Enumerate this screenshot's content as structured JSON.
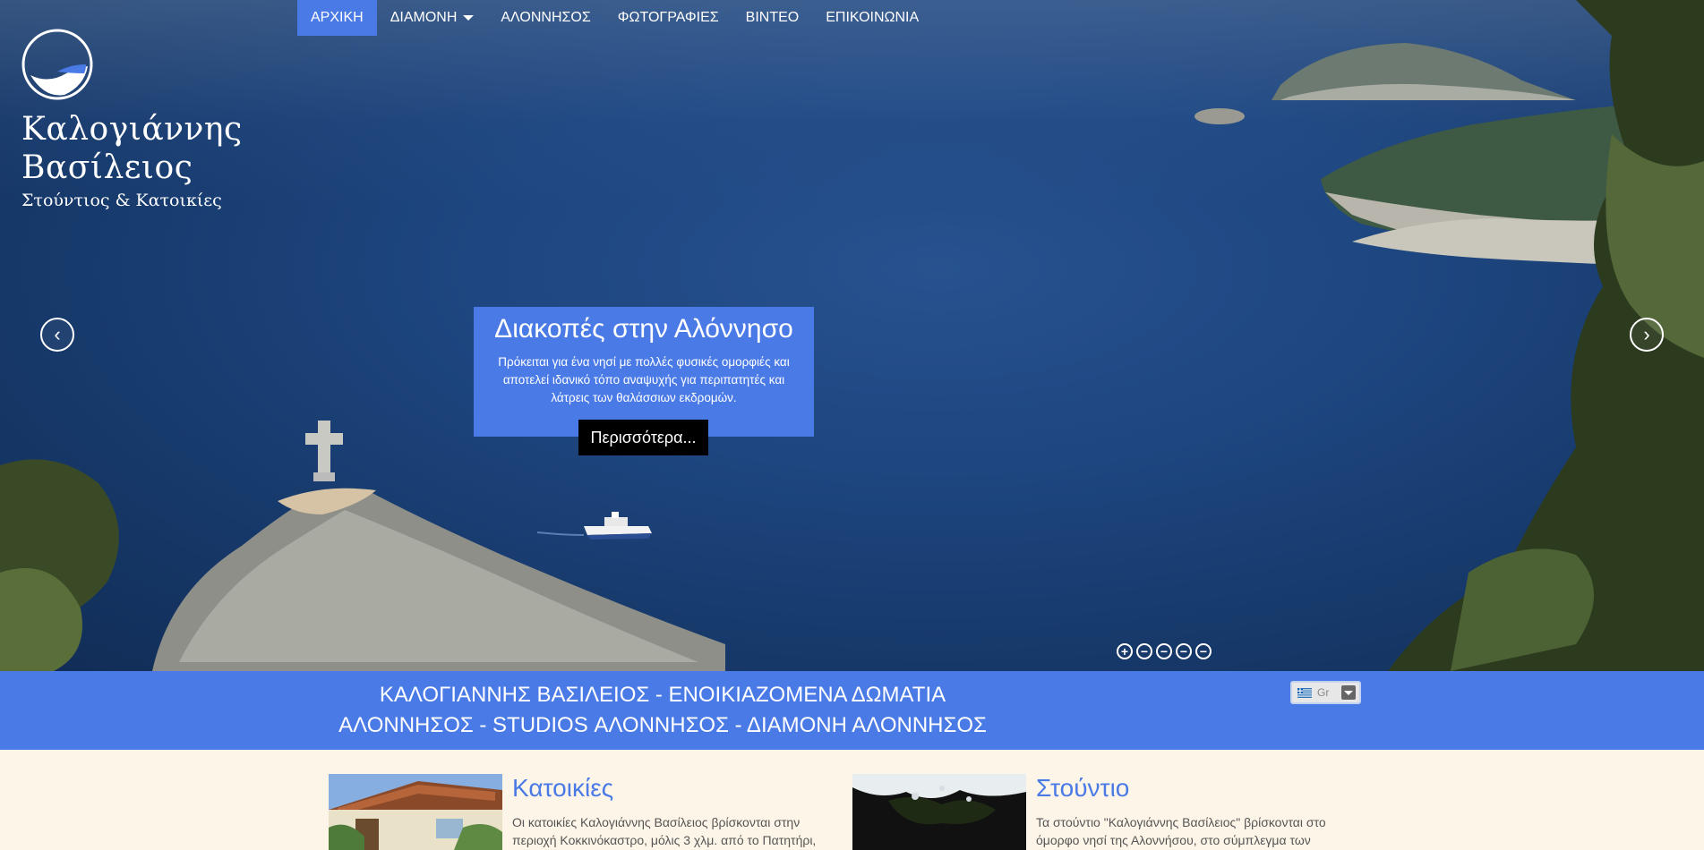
{
  "nav": {
    "items": [
      {
        "label": "ΑΡΧΙΚΗ",
        "active": true
      },
      {
        "label": "ΔΙΑΜΟΝΗ",
        "dropdown": true
      },
      {
        "label": "ΑΛΟΝΝΗΣΟΣ"
      },
      {
        "label": "ΦΩΤΟΓΡΑΦΙΕΣ"
      },
      {
        "label": "ΒΙΝΤΕΟ"
      },
      {
        "label": "ΕΠΙΚΟΙΝΩΝΙΑ"
      }
    ]
  },
  "logo": {
    "name_line1": "Καλογιάννης",
    "name_line2": "Βασίλειος",
    "subtitle": "Στούντιος & Κατοικίες"
  },
  "slider": {
    "title": "Διακοπές στην Αλόννησο",
    "text": "Πρόκειται για ένα νησί με πολλές φυσικές ομορφιές και αποτελεί ιδανικό τόπο αναψυχής για περιπατητές και λάτρεις των θαλάσσιων εκδρομών.",
    "more_label": "Περισσότερα...",
    "prev_icon": "‹",
    "next_icon": "›",
    "dots": [
      "+",
      "−",
      "−",
      "−",
      "−"
    ],
    "active_dot": 0
  },
  "banner": {
    "title": "ΚΑΛΟΓΙΑΝΝΗΣ ΒΑΣΙΛΕΙΟΣ - ΕΝΟΙΚΙΑΖΟΜΕΝΑ ΔΩΜΑΤΙΑ ΑΛΟΝΝΗΣΟΣ - STUDIOS ΑΛΟΝΝΗΣΟΣ - ΔΙΑΜΟΝΗ ΑΛΟΝΝΗΣΟΣ",
    "language": "Gr"
  },
  "cards": [
    {
      "title": "Κατοικίες",
      "text": "Οι κατοικίες Καλογιάννης Βασίλειος βρίσκονται στην περιοχή Κοκκινόκαστρο, μόλις 3 χλμ. από το Πατητήρι,"
    },
    {
      "title": "Στούντιο",
      "text": "Τα στούντιο \"Καλογιάννης Βασίλειος\" βρίσκονται στο όμορφο νησί της Αλοννήσου, στο σύμπλεγμα των"
    }
  ],
  "colors": {
    "accent": "#4a7ae6",
    "sea": "#1e4680",
    "cream": "#fdf5e8"
  }
}
